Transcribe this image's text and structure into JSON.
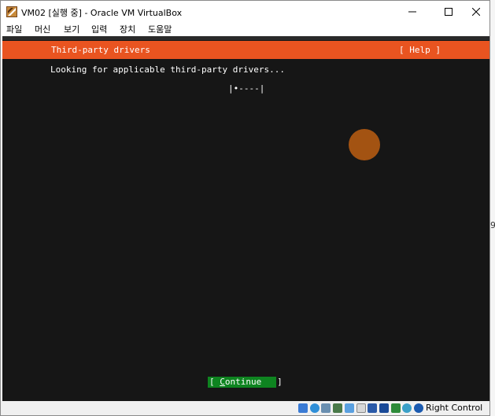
{
  "window": {
    "title": "VM02 [실행 중] - Oracle VM VirtualBox"
  },
  "menu": [
    "파일",
    "머신",
    "보기",
    "입력",
    "장치",
    "도움말"
  ],
  "installer": {
    "header_title": "Third-party drivers",
    "help_label": "[ Help ]",
    "status_text": "Looking for applicable third-party drivers...",
    "spinner_text": "|•----|",
    "continue_prefix": "[ ",
    "continue_hotkey": "C",
    "continue_rest": "ontinue",
    "continue_suffix": "   ]"
  },
  "statusbar": {
    "host_key_label": "Right Control",
    "icons": [
      "hard-disk-icon",
      "optical-drive-icon",
      "audio-icon",
      "network-icon",
      "usb-icon",
      "shared-folders-icon",
      "display-icon",
      "video-capture-icon",
      "recording-icon",
      "cpu-icon",
      "mouse-integration-icon",
      "keyboard-capture-icon"
    ]
  },
  "colors": {
    "installer_header": "#e95420",
    "continue_button": "#0e8420",
    "vm_background": "#161616"
  }
}
